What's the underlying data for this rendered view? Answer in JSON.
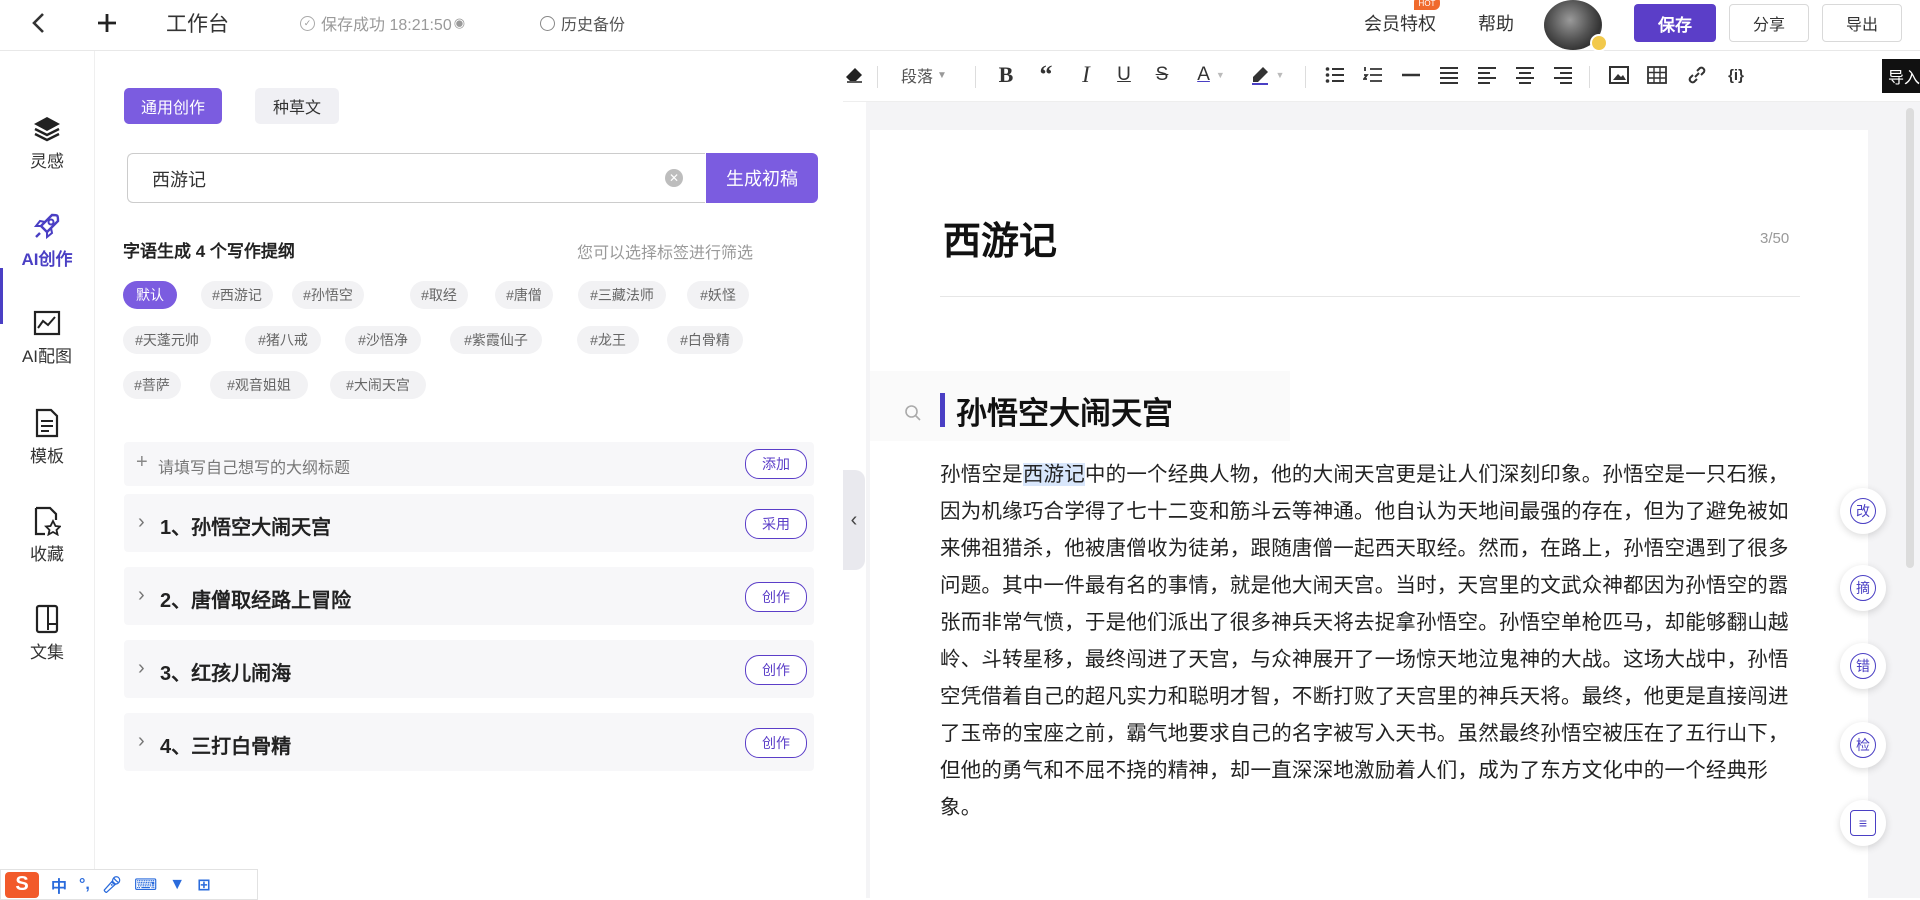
{
  "topbar": {
    "back_icon": "chevron-left-icon",
    "plus_icon": "plus-icon",
    "workspace": "工作台",
    "save_status": "保存成功 18:21:50",
    "history": "历史备份",
    "vip": "会员特权",
    "hot_badge": "HOT",
    "help": "帮助",
    "save": "保存",
    "share": "分享",
    "export": "导出"
  },
  "nav": [
    {
      "label": "灵感",
      "icon": "layers-icon"
    },
    {
      "label": "AI创作",
      "icon": "rocket-icon"
    },
    {
      "label": "AI配图",
      "icon": "image-chart-icon"
    },
    {
      "label": "模板",
      "icon": "document-icon"
    },
    {
      "label": "收藏",
      "icon": "star-doc-icon"
    },
    {
      "label": "文集",
      "icon": "book-icon"
    }
  ],
  "panel": {
    "tab_general": "通用创作",
    "tab_note": "种草文",
    "search_value": "西游记",
    "generate": "生成初稿",
    "outline_count": "字语生成 4 个写作提纲",
    "outline_hint": "您可以选择标签进行筛选",
    "tags": [
      "默认",
      "#西游记",
      "#孙悟空",
      "#取经",
      "#唐僧",
      "#三藏法师",
      "#妖怪",
      "#天蓬元帅",
      "#猪八戒",
      "#沙悟净",
      "#紫霞仙子",
      "#龙王",
      "#白骨精",
      "#菩萨",
      "#观音姐姐",
      "#大闹天宫"
    ],
    "add_placeholder": "请填写自己想写的大纲标题",
    "add": "添加",
    "outlines": [
      {
        "title": "1、孙悟空大闹天宫",
        "action": "采用"
      },
      {
        "title": "2、唐僧取经路上冒险",
        "action": "创作"
      },
      {
        "title": "3、红孩儿闹海",
        "action": "创作"
      },
      {
        "title": "4、三打白骨精",
        "action": "创作"
      }
    ]
  },
  "toolbar": {
    "paragraph": "段落",
    "import": "导入"
  },
  "doc": {
    "title": "西游记",
    "count": "3/50",
    "section": "孙悟空大闹天宫",
    "p_before": "孙悟空是",
    "p_highlight": "西游记",
    "p_after": "中的一个经典人物，他的大闹天宫更是让人们深刻印象。孙悟空是一只石猴，因为机缘巧合学得了七十二变和筋斗云等神通。他自认为天地间最强的存在，但为了避免被如来佛祖猎杀，他被唐僧收为徒弟，跟随唐僧一起西天取经。然而，在路上，孙悟空遇到了很多问题。其中一件最有名的事情，就是他大闹天宫。当时，天宫里的文武众神都因为孙悟空的嚣张而非常气愤，于是他们派出了很多神兵天将去捉拿孙悟空。孙悟空单枪匹马，却能够翻山越岭、斗转星移，最终闯进了天宫，与众神展开了一场惊天地泣鬼神的大战。这场大战中，孙悟空凭借着自己的超凡实力和聪明才智，不断打败了天宫里的神兵天将。最终，他更是直接闯进了玉帝的宝座之前，霸气地要求自己的名字被写入天书。虽然最终孙悟空被压在了五行山下，但他的勇气和不屈不挠的精神，却一直深深地激励着人们，成为了东方文化中的一个经典形象。"
  },
  "side_tools": [
    "改",
    "摘",
    "错",
    "检",
    "≡"
  ],
  "ime": {
    "logo": "S",
    "mode": "中"
  }
}
